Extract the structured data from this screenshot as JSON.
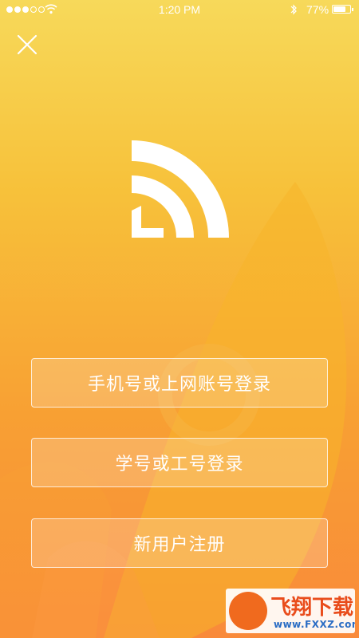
{
  "status_bar": {
    "time": "1:20 PM",
    "battery_percent": "77%",
    "battery_level": 0.77,
    "signal_bars_filled": 3,
    "signal_bars_total": 5
  },
  "icons": {
    "close": "close-icon",
    "logo": "rss-signal-logo-icon"
  },
  "actions": {
    "phone_login": "手机号或上网账号登录",
    "student_staff_login": "学号或工号登录",
    "register": "新用户注册"
  },
  "watermark": {
    "title": "飞翔下载",
    "url": "www.FXXZ.com"
  },
  "colors": {
    "gradient_top": "#f7d95a",
    "gradient_bottom": "#f98a3a",
    "button_border": "#ffffff",
    "watermark_title": "#e94c1b",
    "watermark_url": "#2a6cc4"
  }
}
